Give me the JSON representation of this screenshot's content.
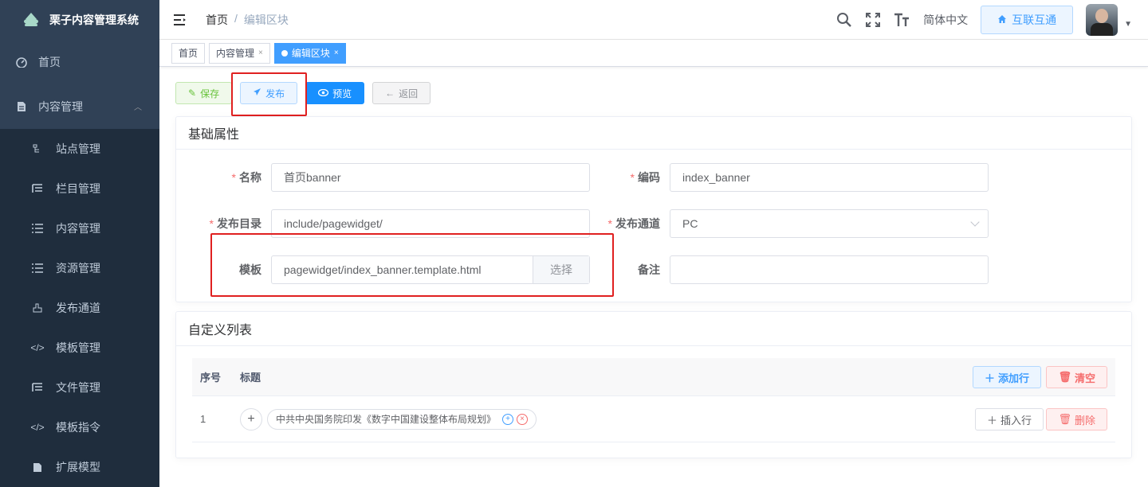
{
  "app": {
    "title": "栗子内容管理系统"
  },
  "sidebar": {
    "top_items": [
      {
        "label": "首页",
        "icon": "dashboard-icon"
      },
      {
        "label": "内容管理",
        "icon": "document-icon",
        "expanded": true
      }
    ],
    "sub_items": [
      {
        "label": "站点管理",
        "icon": "tree-icon"
      },
      {
        "label": "栏目管理",
        "icon": "tree-table-icon"
      },
      {
        "label": "内容管理",
        "icon": "list-icon"
      },
      {
        "label": "资源管理",
        "icon": "list-icon"
      },
      {
        "label": "发布通道",
        "icon": "publish-icon"
      },
      {
        "label": "模板管理",
        "icon": "code-icon"
      },
      {
        "label": "文件管理",
        "icon": "tree-table-icon"
      },
      {
        "label": "模板指令",
        "icon": "code-icon"
      },
      {
        "label": "扩展模型",
        "icon": "model-icon"
      }
    ]
  },
  "navbar": {
    "breadcrumb": [
      "首页",
      "编辑区块"
    ],
    "lang": "简体中文",
    "hulian_label": "互联互通"
  },
  "tags": [
    {
      "label": "首页",
      "active": false,
      "closable": false
    },
    {
      "label": "内容管理",
      "active": false,
      "closable": true
    },
    {
      "label": "编辑区块",
      "active": true,
      "closable": true
    }
  ],
  "toolbar": {
    "save": "保存",
    "publish": "发布",
    "preview": "预览",
    "back": "返回"
  },
  "basic": {
    "title": "基础属性",
    "name_label": "名称",
    "name_value": "首页banner",
    "code_label": "编码",
    "code_value": "index_banner",
    "dir_label": "发布目录",
    "dir_value": "include/pagewidget/",
    "channel_label": "发布通道",
    "channel_value": "PC",
    "template_label": "模板",
    "template_value": "pagewidget/index_banner.template.html",
    "template_button": "选择",
    "remark_label": "备注",
    "remark_value": ""
  },
  "custom": {
    "title": "自定义列表",
    "col_index": "序号",
    "col_title": "标题",
    "add_row": "添加行",
    "clear": "清空",
    "rows": [
      {
        "index": "1",
        "title": "中共中央国务院印发《数字中国建设整体布局规划》",
        "insert": "插入行",
        "delete": "删除"
      }
    ]
  },
  "colors": {
    "sidebar_bg": "#304156",
    "primary": "#409eff",
    "highlight_box": "#e02020"
  }
}
